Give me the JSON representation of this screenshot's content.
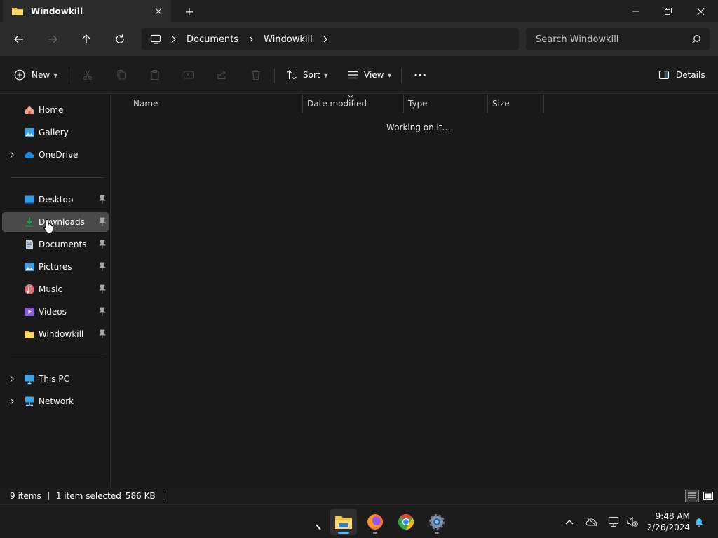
{
  "window": {
    "tab_title": "Windowkill",
    "new_tab": "+"
  },
  "address": {
    "crumbs": [
      "Documents",
      "Windowkill"
    ]
  },
  "search": {
    "placeholder": "Search Windowkill"
  },
  "command_bar": {
    "new_label": "New",
    "sort_label": "Sort",
    "view_label": "View",
    "more_label": "···",
    "details_label": "Details"
  },
  "sidebar": {
    "items": [
      {
        "label": "Home",
        "icon": "home-icon"
      },
      {
        "label": "Gallery",
        "icon": "gallery-icon"
      },
      {
        "label": "OneDrive",
        "icon": "onedrive-icon"
      },
      {
        "label": "Desktop",
        "icon": "desktop-icon"
      },
      {
        "label": "Downloads",
        "icon": "downloads-icon"
      },
      {
        "label": "Documents",
        "icon": "documents-icon"
      },
      {
        "label": "Pictures",
        "icon": "pictures-icon"
      },
      {
        "label": "Music",
        "icon": "music-icon"
      },
      {
        "label": "Videos",
        "icon": "videos-icon"
      },
      {
        "label": "Windowkill",
        "icon": "folder-icon"
      },
      {
        "label": "This PC",
        "icon": "this-pc-icon"
      },
      {
        "label": "Network",
        "icon": "network-icon"
      }
    ],
    "selected": "Downloads"
  },
  "columns": [
    "Name",
    "Date modified",
    "Type",
    "Size"
  ],
  "content": {
    "loading_text": "Working on it..."
  },
  "status": {
    "items": "9 items",
    "selection": "1 item selected",
    "size": "586 KB"
  },
  "taskbar": {
    "time": "9:48 AM",
    "date": "2/26/2024",
    "apps": [
      "file-explorer-icon",
      "firefox-icon",
      "chrome-icon",
      "settings-icon"
    ]
  },
  "colors": {
    "accent": "#4cc2ff",
    "folder": "#f5c342",
    "background": "#191919"
  }
}
